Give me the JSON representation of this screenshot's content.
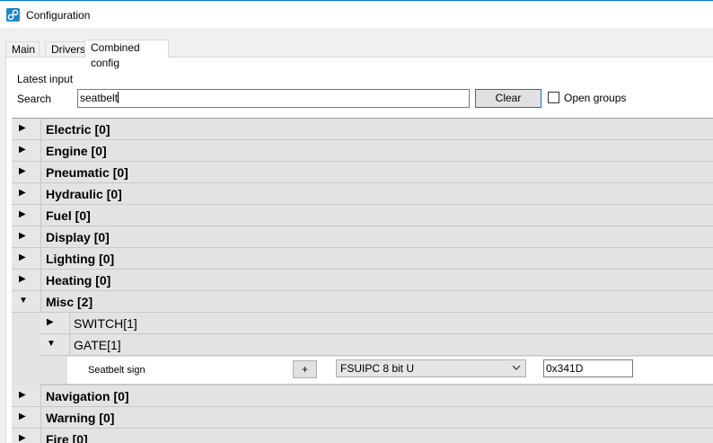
{
  "window": {
    "title": "Configuration"
  },
  "tabs": [
    {
      "label": "Main"
    },
    {
      "label": "Drivers"
    },
    {
      "label": "Combined config"
    }
  ],
  "header": {
    "latest_input_label": "Latest input",
    "search_label": "Search"
  },
  "search": {
    "value": "seatbelt",
    "clear_label": "Clear",
    "open_groups_label": "Open groups",
    "open_groups_checked": false
  },
  "groups": [
    {
      "label": "Electric [0]",
      "expanded": false
    },
    {
      "label": "Engine [0]",
      "expanded": false
    },
    {
      "label": "Pneumatic [0]",
      "expanded": false
    },
    {
      "label": "Hydraulic [0]",
      "expanded": false
    },
    {
      "label": "Fuel [0]",
      "expanded": false
    },
    {
      "label": "Display [0]",
      "expanded": false
    },
    {
      "label": "Lighting [0]",
      "expanded": false
    },
    {
      "label": "Heating [0]",
      "expanded": false
    },
    {
      "label": "Misc [2]",
      "expanded": true
    },
    {
      "label": "Navigation [0]",
      "expanded": false
    },
    {
      "label": "Warning [0]",
      "expanded": false
    },
    {
      "label": "Fire [0]",
      "expanded": false
    }
  ],
  "misc": {
    "subgroups": [
      {
        "label": "SWITCH[1]",
        "expanded": false
      },
      {
        "label": "GATE[1]",
        "expanded": true
      }
    ],
    "gate_item": {
      "name": "Seatbelt sign",
      "add_label": "+",
      "type_value": "FSUIPC 8 bit U",
      "offset_value": "0x341D"
    }
  },
  "icons": {
    "collapsed": "▶",
    "expanded": "▼",
    "dropdown": "chevron-down-icon"
  }
}
